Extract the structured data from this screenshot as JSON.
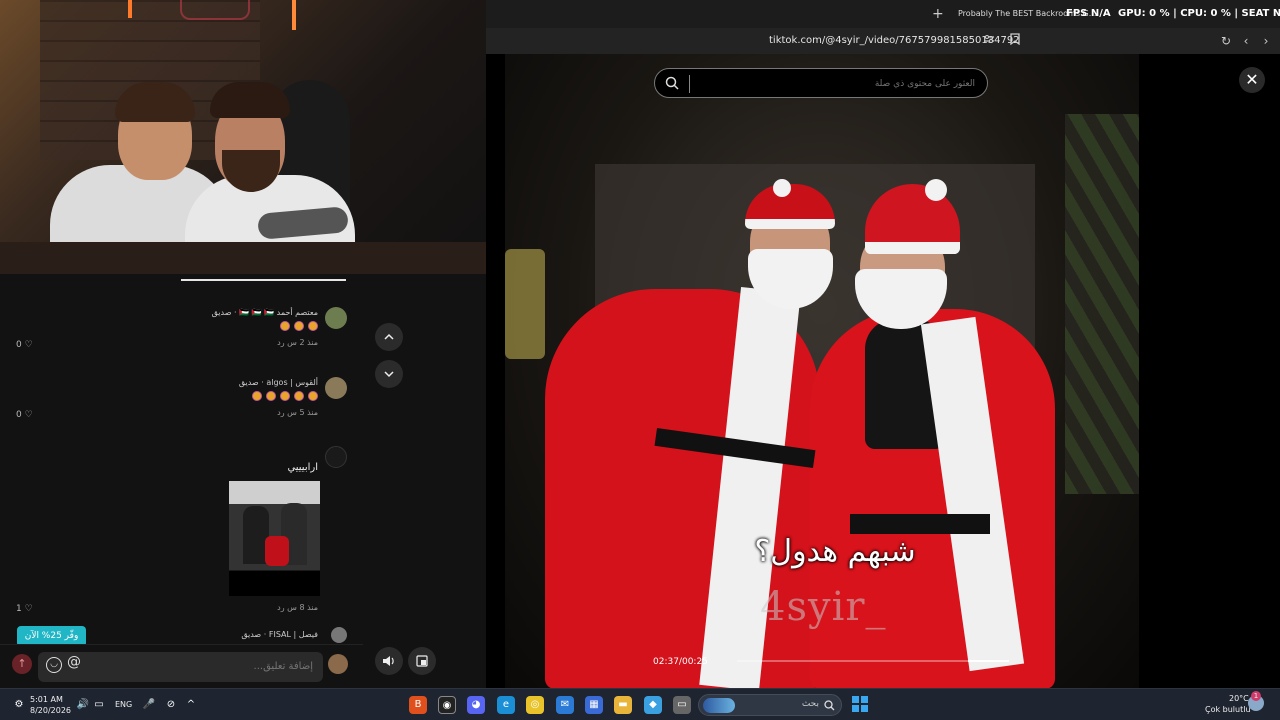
{
  "browser": {
    "tab_title": "Probably The BEST Backrooms G...",
    "url": "tiktok.com/@4syir_/video/7675799815850134792"
  },
  "overlay": {
    "fps": "FPS N/A",
    "gpu": "GPU: 0 % | CPU: 0 % | SEAT N/A"
  },
  "tiktok": {
    "search_placeholder": "العثور على محتوى ذي صلة",
    "caption": "شبهم هدول؟",
    "watermark": "4syir_",
    "timecode": "02:37/00:25",
    "progress": 0.15
  },
  "comments": {
    "items": [
      {
        "name": "معتصم أحمد 🇵🇸 🇵🇸 🇵🇸 · صديق",
        "meta": "منذ 2 س   رد",
        "likes": "0 ♡"
      },
      {
        "name": "ألقوس | algos · صديق",
        "meta": "منذ 5 س   رد",
        "likes": "0 ♡"
      },
      {
        "name": "",
        "text": "ارابيييي",
        "meta": "منذ 8 س   رد",
        "likes": "1 ♡"
      },
      {
        "name": "فيصل | FISAL · صديق"
      }
    ],
    "promo_badge": "وفّر 25% الآن",
    "input_placeholder": "إضافة تعليق..."
  },
  "taskbar": {
    "time": "5:01 AM",
    "date": "8/20/2026",
    "lang": "ENG",
    "search_label": "بحث",
    "weather_temp": "20°C",
    "weather_desc": "Çok bulutlu",
    "notification_count": "1"
  }
}
